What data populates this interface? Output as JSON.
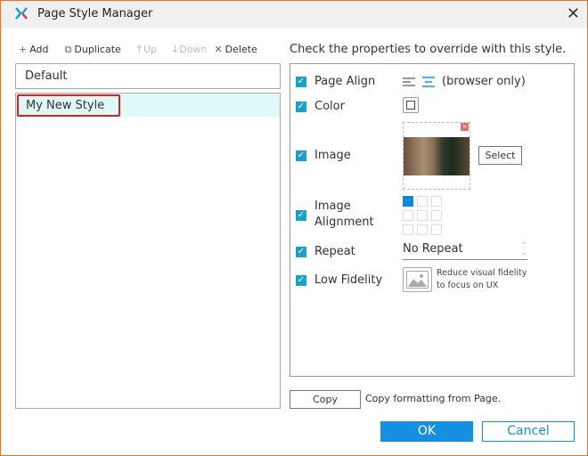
{
  "window": {
    "title": "Page Style Manager"
  },
  "toolbar": {
    "add": "Add",
    "duplicate": "Duplicate",
    "up": "Up",
    "down": "Down",
    "delete": "Delete"
  },
  "styles": {
    "default": "Default",
    "items": [
      "My New Style"
    ]
  },
  "props": {
    "hint": "Check the properties to override with this style.",
    "page_align": {
      "label": "Page Align",
      "note": "(browser only)",
      "checked": true,
      "selected": "center"
    },
    "color": {
      "label": "Color",
      "checked": true
    },
    "image": {
      "label": "Image",
      "checked": true,
      "select_label": "Select"
    },
    "image_alignment": {
      "label1": "Image",
      "label2": "Alignment",
      "checked": true,
      "selected": "top-left"
    },
    "repeat": {
      "label": "Repeat",
      "value": "No Repeat",
      "checked": true
    },
    "low_fidelity": {
      "label": "Low Fidelity",
      "checked": true,
      "desc1": "Reduce visual fidelity",
      "desc2": "to focus on UX"
    }
  },
  "copy": {
    "button": "Copy",
    "label": "Copy formatting from Page."
  },
  "footer": {
    "ok": "OK",
    "cancel": "Cancel"
  },
  "colors": {
    "accent": "#1590e0",
    "checkbox": "#1ba0c8",
    "selection": "#dff8f8",
    "highlight": "#e02020"
  }
}
